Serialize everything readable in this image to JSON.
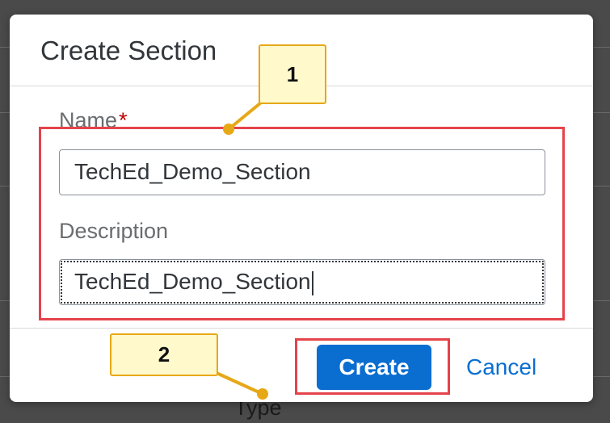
{
  "background": {
    "partial_label": "Type"
  },
  "dialog": {
    "title": "Create Section",
    "name_field": {
      "label": "Name",
      "required_marker": "*",
      "value": "TechEd_Demo_Section"
    },
    "description_field": {
      "label": "Description",
      "value": "TechEd_Demo_Section"
    },
    "buttons": {
      "create": "Create",
      "cancel": "Cancel"
    }
  },
  "annotations": {
    "callout_1": "1",
    "callout_2": "2",
    "highlight_color": "#e5434a",
    "callout_fill": "#fff9cc",
    "callout_border": "#e6a817"
  },
  "colors": {
    "primary_button": "#0a6ed1",
    "required": "#bb0000"
  }
}
